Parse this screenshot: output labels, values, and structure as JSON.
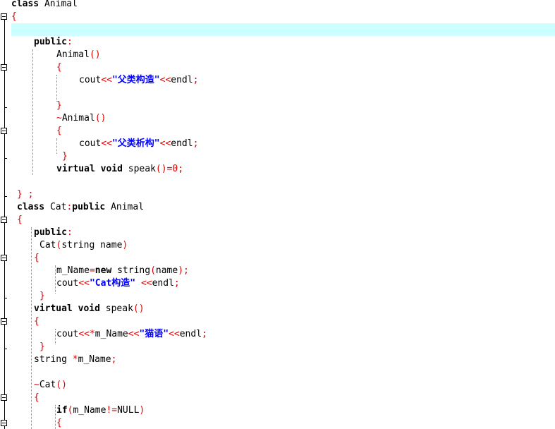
{
  "editor": {
    "colors": {
      "keyword": "#000000",
      "operator": "#e00000",
      "string": "#0000ff",
      "number": "#e00000",
      "current_line": "#ccffff"
    },
    "lines": [
      {
        "indent": 16,
        "tokens": [
          {
            "t": "kw",
            "v": "class"
          },
          {
            "t": "id",
            "v": " Animal"
          }
        ]
      },
      {
        "indent": 16,
        "tokens": [
          {
            "t": "op",
            "v": "{"
          }
        ]
      },
      {
        "indent": 16,
        "tokens": []
      },
      {
        "indent": 48,
        "tokens": [
          {
            "t": "kw",
            "v": "public"
          },
          {
            "t": "op",
            "v": ":"
          }
        ]
      },
      {
        "indent": 80,
        "tokens": [
          {
            "t": "id",
            "v": "Animal"
          },
          {
            "t": "op",
            "v": "()"
          }
        ]
      },
      {
        "indent": 80,
        "tokens": [
          {
            "t": "op",
            "v": "{"
          }
        ]
      },
      {
        "indent": 112,
        "tokens": [
          {
            "t": "id",
            "v": "cout"
          },
          {
            "t": "op",
            "v": "<<"
          },
          {
            "t": "str",
            "v": "\"父类构造\""
          },
          {
            "t": "op",
            "v": "<<"
          },
          {
            "t": "id",
            "v": "endl"
          },
          {
            "t": "op",
            "v": ";"
          }
        ]
      },
      {
        "indent": 16,
        "tokens": []
      },
      {
        "indent": 80,
        "tokens": [
          {
            "t": "op",
            "v": "}"
          }
        ]
      },
      {
        "indent": 80,
        "tokens": [
          {
            "t": "op",
            "v": "~"
          },
          {
            "t": "id",
            "v": "Animal"
          },
          {
            "t": "op",
            "v": "()"
          }
        ]
      },
      {
        "indent": 80,
        "tokens": [
          {
            "t": "op",
            "v": "{"
          }
        ]
      },
      {
        "indent": 112,
        "tokens": [
          {
            "t": "id",
            "v": "cout"
          },
          {
            "t": "op",
            "v": "<<"
          },
          {
            "t": "str",
            "v": "\"父类析构\""
          },
          {
            "t": "op",
            "v": "<<"
          },
          {
            "t": "id",
            "v": "endl"
          },
          {
            "t": "op",
            "v": ";"
          }
        ]
      },
      {
        "indent": 88,
        "tokens": [
          {
            "t": "op",
            "v": "}"
          }
        ]
      },
      {
        "indent": 80,
        "tokens": [
          {
            "t": "kw",
            "v": "virtual"
          },
          {
            "t": "id",
            "v": " "
          },
          {
            "t": "kw",
            "v": "void"
          },
          {
            "t": "id",
            "v": " speak"
          },
          {
            "t": "op",
            "v": "()="
          },
          {
            "t": "num",
            "v": "0"
          },
          {
            "t": "op",
            "v": ";"
          }
        ]
      },
      {
        "indent": 16,
        "tokens": []
      },
      {
        "indent": 24,
        "tokens": [
          {
            "t": "op",
            "v": "} ;"
          }
        ]
      },
      {
        "indent": 24,
        "tokens": [
          {
            "t": "kw",
            "v": "class"
          },
          {
            "t": "id",
            "v": " Cat"
          },
          {
            "t": "op",
            "v": ":"
          },
          {
            "t": "kw",
            "v": "public"
          },
          {
            "t": "id",
            "v": " Animal"
          }
        ]
      },
      {
        "indent": 24,
        "tokens": [
          {
            "t": "op",
            "v": "{"
          }
        ]
      },
      {
        "indent": 48,
        "tokens": [
          {
            "t": "kw",
            "v": "public"
          },
          {
            "t": "op",
            "v": ":"
          }
        ]
      },
      {
        "indent": 56,
        "tokens": [
          {
            "t": "id",
            "v": "Cat"
          },
          {
            "t": "op",
            "v": "("
          },
          {
            "t": "id",
            "v": "string name"
          },
          {
            "t": "op",
            "v": ")"
          }
        ]
      },
      {
        "indent": 48,
        "tokens": [
          {
            "t": "op",
            "v": "{"
          }
        ]
      },
      {
        "indent": 80,
        "tokens": [
          {
            "t": "id",
            "v": "m_Name"
          },
          {
            "t": "op",
            "v": "="
          },
          {
            "t": "kw",
            "v": "new"
          },
          {
            "t": "id",
            "v": " string"
          },
          {
            "t": "op",
            "v": "("
          },
          {
            "t": "id",
            "v": "name"
          },
          {
            "t": "op",
            "v": ");"
          }
        ]
      },
      {
        "indent": 80,
        "tokens": [
          {
            "t": "id",
            "v": "cout"
          },
          {
            "t": "op",
            "v": "<<"
          },
          {
            "t": "str",
            "v": "\"Cat构造\""
          },
          {
            "t": "id",
            "v": " "
          },
          {
            "t": "op",
            "v": "<<"
          },
          {
            "t": "id",
            "v": "endl"
          },
          {
            "t": "op",
            "v": ";"
          }
        ]
      },
      {
        "indent": 56,
        "tokens": [
          {
            "t": "op",
            "v": "}"
          }
        ]
      },
      {
        "indent": 48,
        "tokens": [
          {
            "t": "kw",
            "v": "virtual"
          },
          {
            "t": "id",
            "v": " "
          },
          {
            "t": "kw",
            "v": "void"
          },
          {
            "t": "id",
            "v": " speak"
          },
          {
            "t": "op",
            "v": "()"
          }
        ]
      },
      {
        "indent": 48,
        "tokens": [
          {
            "t": "op",
            "v": "{"
          }
        ]
      },
      {
        "indent": 80,
        "tokens": [
          {
            "t": "id",
            "v": "cout"
          },
          {
            "t": "op",
            "v": "<<*"
          },
          {
            "t": "id",
            "v": "m_Name"
          },
          {
            "t": "op",
            "v": "<<"
          },
          {
            "t": "str",
            "v": "\"猫语\""
          },
          {
            "t": "op",
            "v": "<<"
          },
          {
            "t": "id",
            "v": "endl"
          },
          {
            "t": "op",
            "v": ";"
          }
        ]
      },
      {
        "indent": 56,
        "tokens": [
          {
            "t": "op",
            "v": "}"
          }
        ]
      },
      {
        "indent": 48,
        "tokens": [
          {
            "t": "id",
            "v": "string "
          },
          {
            "t": "op",
            "v": "*"
          },
          {
            "t": "id",
            "v": "m_Name"
          },
          {
            "t": "op",
            "v": ";"
          }
        ]
      },
      {
        "indent": 16,
        "tokens": []
      },
      {
        "indent": 48,
        "tokens": [
          {
            "t": "op",
            "v": "~"
          },
          {
            "t": "id",
            "v": "Cat"
          },
          {
            "t": "op",
            "v": "()"
          }
        ]
      },
      {
        "indent": 48,
        "tokens": [
          {
            "t": "op",
            "v": "{"
          }
        ]
      },
      {
        "indent": 80,
        "tokens": [
          {
            "t": "kw",
            "v": "if"
          },
          {
            "t": "op",
            "v": "("
          },
          {
            "t": "id",
            "v": "m_Name"
          },
          {
            "t": "op",
            "v": "!="
          },
          {
            "t": "id",
            "v": "NULL"
          },
          {
            "t": "op",
            "v": ")"
          }
        ]
      },
      {
        "indent": 80,
        "tokens": [
          {
            "t": "op",
            "v": "{"
          }
        ]
      }
    ]
  }
}
